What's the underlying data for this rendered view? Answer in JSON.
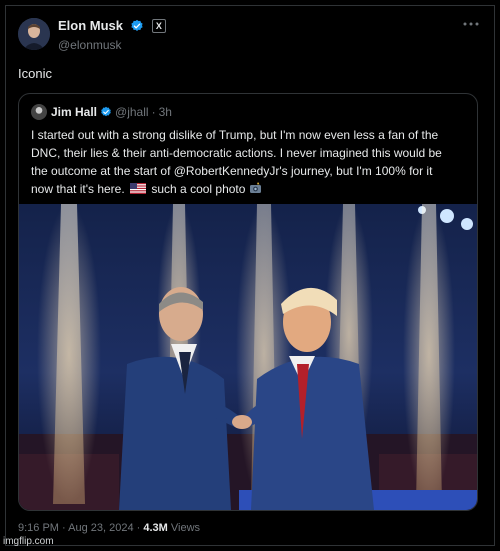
{
  "post": {
    "author_name": "Elon Musk",
    "author_handle": "@elonmusk",
    "verified_color": "#1d9bf0",
    "affiliate_badge": "X",
    "text": "Iconic",
    "more_icon": "more-horizontal-icon"
  },
  "quote": {
    "author_name": "Jim Hall",
    "author_handle": "@jhall",
    "separator": "·",
    "time": "3h",
    "text_line_1": "I started out with a strong dislike of Trump, but I'm now even less a fan of the",
    "text_line_2": "DNC, their lies & their anti-democratic actions. I never imagined this would be",
    "text_line_3": "the outcome at the start of @RobertKennedyJr's journey, but I'm 100% for it",
    "text_line_4_before": "now that it's here.",
    "text_line_4_after": "such a cool photo",
    "flag_icon": "us-flag-icon",
    "camera_icon": "camera-flash-icon"
  },
  "meta": {
    "time": "9:16 PM · Aug 23, 2024 · ",
    "views_count": "4.3M",
    "views_label": " Views"
  },
  "watermark": "imgflip.com"
}
